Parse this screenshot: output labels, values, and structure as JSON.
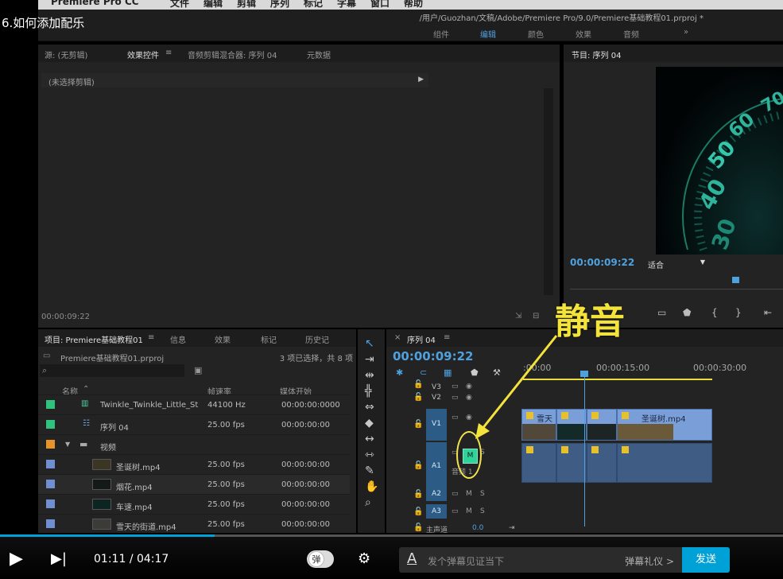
{
  "video": {
    "title": "6.如何添加配乐"
  },
  "menubar": {
    "app": "Premiere Pro CC",
    "items": [
      "文件",
      "编辑",
      "剪辑",
      "序列",
      "标记",
      "字幕",
      "窗口",
      "帮助"
    ]
  },
  "path": "/用户/Guozhan/文稿/Adobe/Premiere Pro/9.0/Premiere基础教程01.prproj *",
  "workspace": {
    "items": [
      {
        "label": "组件",
        "active": false
      },
      {
        "label": "编辑",
        "active": true
      },
      {
        "label": "颜色",
        "active": false
      },
      {
        "label": "效果",
        "active": false
      },
      {
        "label": "音频",
        "active": false
      }
    ],
    "more": "»"
  },
  "source_panel": {
    "tabs": [
      "源: (无剪辑)",
      "效果控件",
      "≡",
      "音频剪辑混合器: 序列 04",
      "元数据"
    ],
    "no_clip": "(未选择剪辑)",
    "timecode": "00:00:09:22"
  },
  "program_panel": {
    "tab": "节目: 序列 04",
    "timecode": "00:00:09:22",
    "fit": "适合",
    "dial_numbers": [
      "70",
      "60",
      "50",
      "40",
      "30"
    ]
  },
  "project_panel": {
    "tabs": [
      "项目: Premiere基础教程01",
      "≡",
      "信息",
      "效果",
      "标记",
      "历史记"
    ],
    "project_file": "Premiere基础教程01.prproj",
    "selection": "3 项已选择，共 8 项",
    "columns": {
      "name": "名称",
      "rate": "帧速率",
      "start": "媒体开始"
    },
    "rows": [
      {
        "name": "Twinkle_Twinkle_Little_St",
        "rate": "44100 Hz",
        "start": "00:00:00:0000",
        "color": "#2ec27e",
        "kind": "audio"
      },
      {
        "name": "序列 04",
        "rate": "25.00 fps",
        "start": "00:00:00:00",
        "color": "#2ec27e",
        "kind": "sequence"
      },
      {
        "name": "视频",
        "rate": "",
        "start": "",
        "color": "#e8922a",
        "kind": "folder"
      },
      {
        "name": "圣诞树.mp4",
        "rate": "25.00 fps",
        "start": "00:00:00:00",
        "color": "#6f8fd0",
        "kind": "clip"
      },
      {
        "name": "烟花.mp4",
        "rate": "25.00 fps",
        "start": "00:00:00:00",
        "color": "#6f8fd0",
        "kind": "clip"
      },
      {
        "name": "车速.mp4",
        "rate": "25.00 fps",
        "start": "00:00:00:00",
        "color": "#6f8fd0",
        "kind": "clip"
      },
      {
        "name": "雪天的街道.mp4",
        "rate": "25.00 fps",
        "start": "00:00:00:00",
        "color": "#6f8fd0",
        "kind": "clip"
      }
    ]
  },
  "timeline": {
    "tab": "序列 04",
    "timecode": "00:00:09:22",
    "ruler": [
      ":00:00",
      "00:00:15:00",
      "00:00:30:00"
    ],
    "tracks": {
      "V3": "V3",
      "V2": "V2",
      "V1": "V1",
      "A1": "A1",
      "A1_name": "音频 1",
      "A2": "A2",
      "A3": "A3",
      "master": "主声道",
      "master_value": "0.0"
    },
    "clips": {
      "first": "雪天",
      "last": "圣诞树.mp4"
    },
    "mute": "M",
    "solo": "S"
  },
  "annotation": "静音",
  "player": {
    "current": "01:11",
    "total": "04:17",
    "separator": "/",
    "danmu_toggle": "弹",
    "danmu_placeholder": "发个弹幕见证当下",
    "danmu_gift": "弹幕礼仪 >",
    "send": "发送"
  }
}
